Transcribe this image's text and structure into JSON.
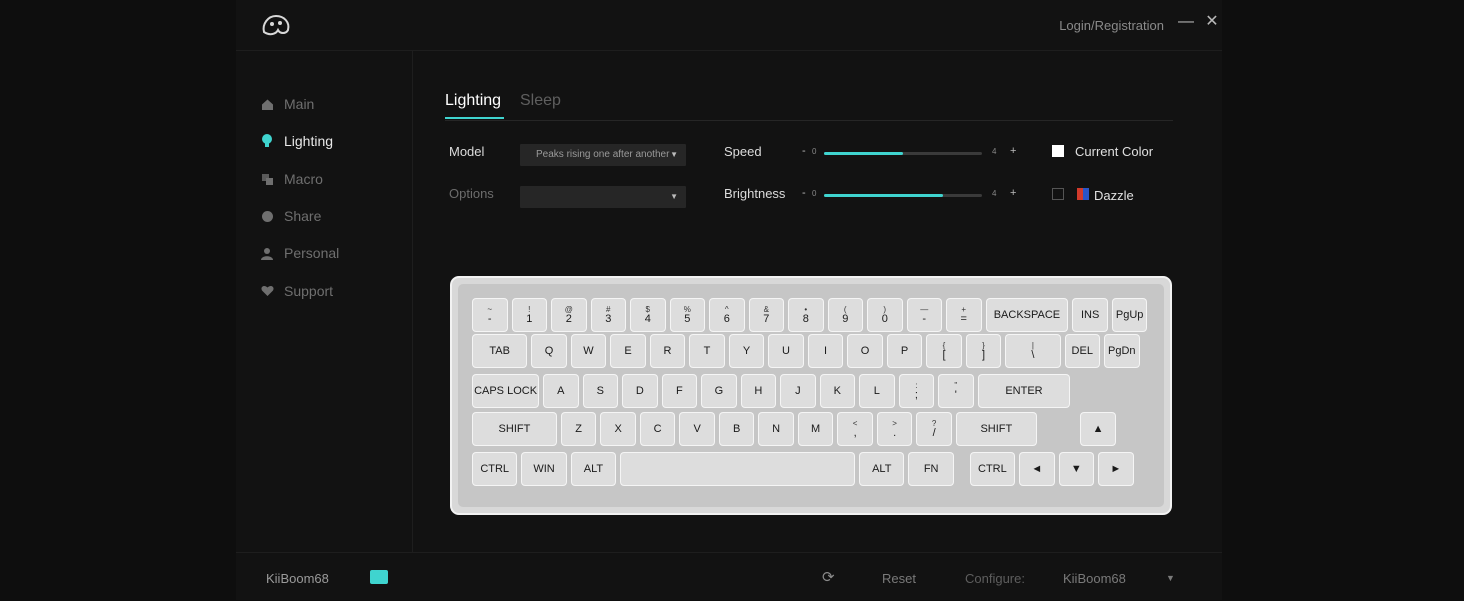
{
  "header": {
    "login_label": "Login/Registration",
    "minimize_icon": "minimize-icon",
    "close_icon": "close-icon"
  },
  "sidebar": {
    "items": [
      {
        "label": "Main",
        "icon": "home-icon",
        "active": false
      },
      {
        "label": "Lighting",
        "icon": "bulb-icon",
        "active": true
      },
      {
        "label": "Macro",
        "icon": "macro-icon",
        "active": false
      },
      {
        "label": "Share",
        "icon": "share-icon",
        "active": false
      },
      {
        "label": "Personal",
        "icon": "person-icon",
        "active": false
      },
      {
        "label": "Support",
        "icon": "heart-icon",
        "active": false
      }
    ]
  },
  "tabs": [
    {
      "label": "Lighting",
      "active": true
    },
    {
      "label": "Sleep",
      "active": false
    }
  ],
  "controls": {
    "model_label": "Model",
    "model_value": "Peaks rising one after another",
    "options_label": "Options",
    "options_value": "",
    "speed_label": "Speed",
    "speed_min": "0",
    "speed_max": "4",
    "speed_fraction": 0.5,
    "brightness_label": "Brightness",
    "brightness_min": "0",
    "brightness_max": "4",
    "brightness_fraction": 0.75,
    "current_color_label": "Current Color",
    "current_color_checked": true,
    "dazzle_label": "Dazzle",
    "dazzle_checked": false
  },
  "keyboard": {
    "rows": [
      [
        {
          "m": "-",
          "s": "~"
        },
        {
          "m": "1",
          "s": "!"
        },
        {
          "m": "2",
          "s": "@"
        },
        {
          "m": "3",
          "s": "#"
        },
        {
          "m": "4",
          "s": "$"
        },
        {
          "m": "5",
          "s": "%"
        },
        {
          "m": "6",
          "s": "^"
        },
        {
          "m": "7",
          "s": "&"
        },
        {
          "m": "8",
          "s": "•"
        },
        {
          "m": "9",
          "s": "("
        },
        {
          "m": "0",
          "s": ")"
        },
        {
          "m": "-",
          "s": "—"
        },
        {
          "m": "=",
          "s": "+"
        },
        {
          "m": "BACKSPACE",
          "s": ""
        },
        {
          "m": "INS",
          "s": ""
        },
        {
          "m": "PgUp",
          "s": ""
        }
      ],
      [
        {
          "m": "TAB",
          "s": ""
        },
        {
          "m": "Q",
          "s": ""
        },
        {
          "m": "W",
          "s": ""
        },
        {
          "m": "E",
          "s": ""
        },
        {
          "m": "R",
          "s": ""
        },
        {
          "m": "T",
          "s": ""
        },
        {
          "m": "Y",
          "s": ""
        },
        {
          "m": "U",
          "s": ""
        },
        {
          "m": "I",
          "s": ""
        },
        {
          "m": "O",
          "s": ""
        },
        {
          "m": "P",
          "s": ""
        },
        {
          "m": "[",
          "s": "{"
        },
        {
          "m": "]",
          "s": "}"
        },
        {
          "m": "\\",
          "s": "|"
        },
        {
          "m": "DEL",
          "s": ""
        },
        {
          "m": "PgDn",
          "s": ""
        }
      ],
      [
        {
          "m": "CAPS LOCK",
          "s": ""
        },
        {
          "m": "A",
          "s": ""
        },
        {
          "m": "S",
          "s": ""
        },
        {
          "m": "D",
          "s": ""
        },
        {
          "m": "F",
          "s": ""
        },
        {
          "m": "G",
          "s": ""
        },
        {
          "m": "H",
          "s": ""
        },
        {
          "m": "J",
          "s": ""
        },
        {
          "m": "K",
          "s": ""
        },
        {
          "m": "L",
          "s": ""
        },
        {
          "m": ";",
          "s": ":"
        },
        {
          "m": "'",
          "s": "\""
        },
        {
          "m": "ENTER",
          "s": ""
        }
      ],
      [
        {
          "m": "SHIFT",
          "s": ""
        },
        {
          "m": "Z",
          "s": ""
        },
        {
          "m": "X",
          "s": ""
        },
        {
          "m": "C",
          "s": ""
        },
        {
          "m": "V",
          "s": ""
        },
        {
          "m": "B",
          "s": ""
        },
        {
          "m": "N",
          "s": ""
        },
        {
          "m": "M",
          "s": ""
        },
        {
          "m": ",",
          "s": "<"
        },
        {
          "m": ".",
          "s": ">"
        },
        {
          "m": "/",
          "s": "?"
        },
        {
          "m": "SHIFT",
          "s": ""
        },
        {
          "m": "▲",
          "s": ""
        }
      ],
      [
        {
          "m": "CTRL",
          "s": ""
        },
        {
          "m": "WIN",
          "s": ""
        },
        {
          "m": "ALT",
          "s": ""
        },
        {
          "m": "",
          "s": ""
        },
        {
          "m": "ALT",
          "s": ""
        },
        {
          "m": "FN",
          "s": ""
        },
        {
          "m": "CTRL",
          "s": ""
        },
        {
          "m": "◄",
          "s": ""
        },
        {
          "m": "▼",
          "s": ""
        },
        {
          "m": "►",
          "s": ""
        }
      ]
    ]
  },
  "footer": {
    "device_name": "KiiBoom68",
    "reset_label": "Reset",
    "configure_label": "Configure:",
    "configure_value": "KiiBoom68"
  },
  "colors": {
    "accent": "#3fd4cf",
    "bg": "#121212"
  }
}
